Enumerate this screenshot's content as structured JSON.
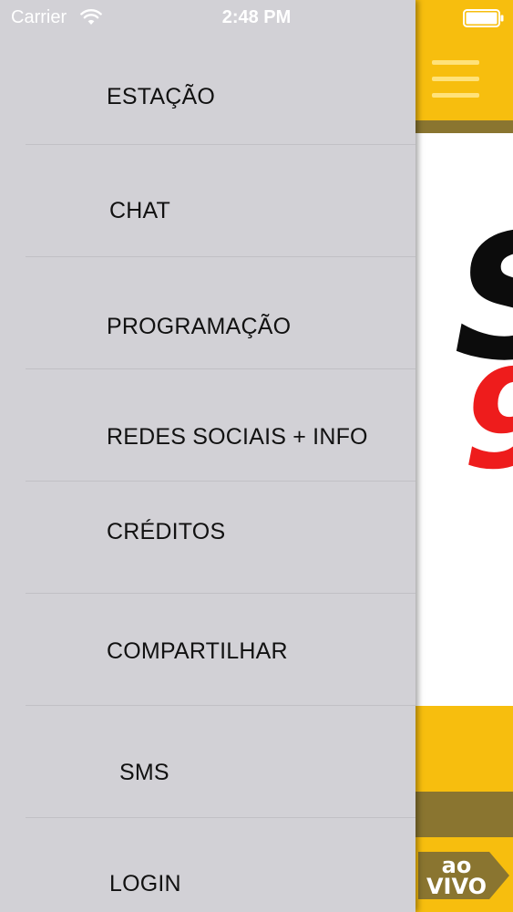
{
  "status_bar": {
    "carrier": "Carrier",
    "time": "2:48 PM",
    "wifi_icon": "wifi-icon",
    "battery_icon": "battery-icon"
  },
  "menu": {
    "items": [
      {
        "label": "ESTAÇÃO"
      },
      {
        "label": "CHAT"
      },
      {
        "label": "PROGRAMAÇÃO"
      },
      {
        "label": "REDES SOCIAIS + INFO"
      },
      {
        "label": "CRÉDITOS"
      },
      {
        "label": "COMPARTILHAR"
      },
      {
        "label": "SMS"
      },
      {
        "label": "LOGIN"
      }
    ]
  },
  "app": {
    "menu_icon": "hamburger-menu-icon",
    "logo_letter": "S",
    "logo_digit": "9",
    "live_badge": {
      "line1": "ao",
      "line2": "VIVO"
    }
  },
  "colors": {
    "drawer_background": "#d2d1d6",
    "brand_yellow": "#f7be0e",
    "brand_brown": "#8a7530",
    "logo_red": "#ee1c1c",
    "logo_black": "#0c0c0c"
  }
}
